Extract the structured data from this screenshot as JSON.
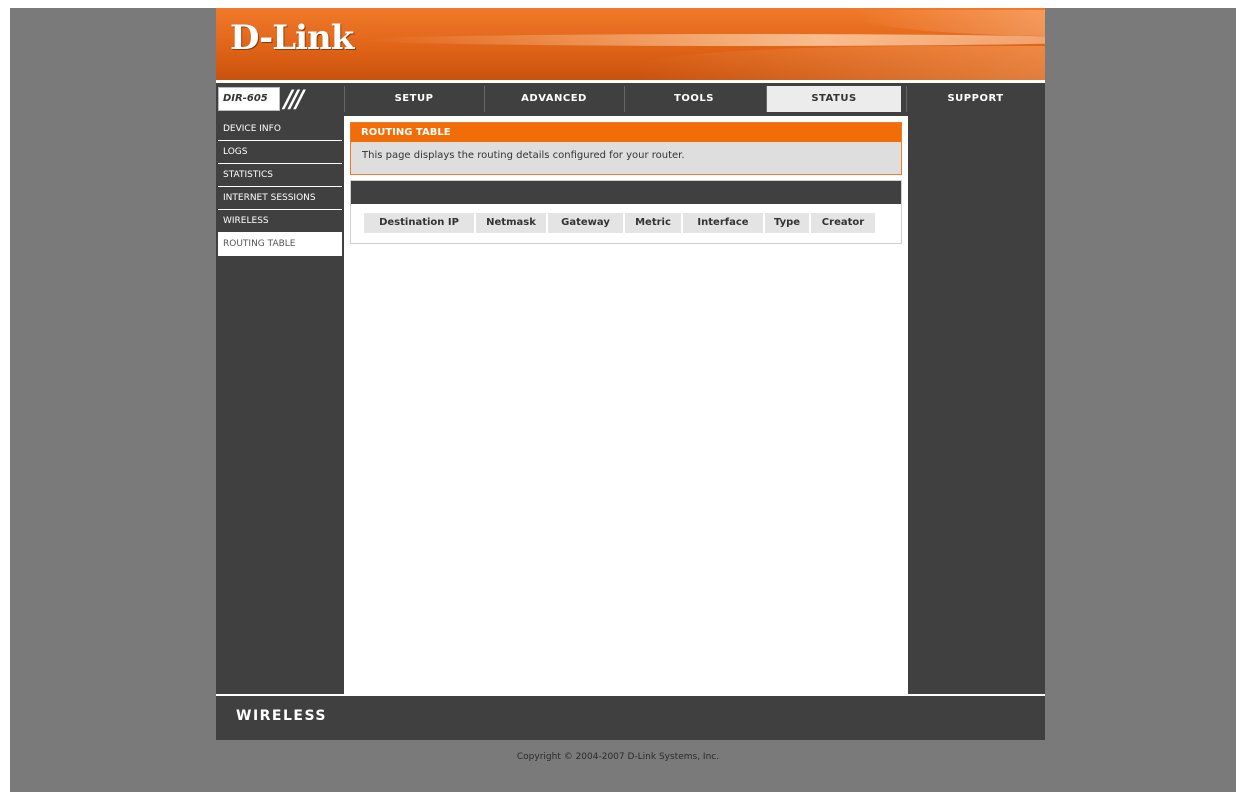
{
  "brand": {
    "logo": "D-Link",
    "model": "DIR-605",
    "model_mark": "///"
  },
  "topnav": [
    {
      "label": "SETUP",
      "active": false
    },
    {
      "label": "ADVANCED",
      "active": false
    },
    {
      "label": "TOOLS",
      "active": false
    },
    {
      "label": "STATUS",
      "active": true
    },
    {
      "label": "SUPPORT",
      "active": false
    }
  ],
  "sidebar": {
    "items": [
      {
        "label": "DEVICE INFO",
        "active": false
      },
      {
        "label": "LOGS",
        "active": false
      },
      {
        "label": "STATISTICS",
        "active": false
      },
      {
        "label": "INTERNET SESSIONS",
        "active": false
      },
      {
        "label": "WIRELESS",
        "active": false
      },
      {
        "label": "ROUTING TABLE",
        "active": true
      }
    ]
  },
  "main": {
    "title": "ROUTING TABLE",
    "description": "This page displays the routing details configured for your router.",
    "table_headers": [
      "Destination IP",
      "Netmask",
      "Gateway",
      "Metric",
      "Interface",
      "Type",
      "Creator"
    ],
    "rows": []
  },
  "footer": {
    "brand": "WIRELESS"
  },
  "copyright": "Copyright © 2004-2007 D-Link Systems, Inc.",
  "colors": {
    "accent": "#f06d08",
    "dark": "#404040",
    "page_bg": "#7a7a7a"
  }
}
